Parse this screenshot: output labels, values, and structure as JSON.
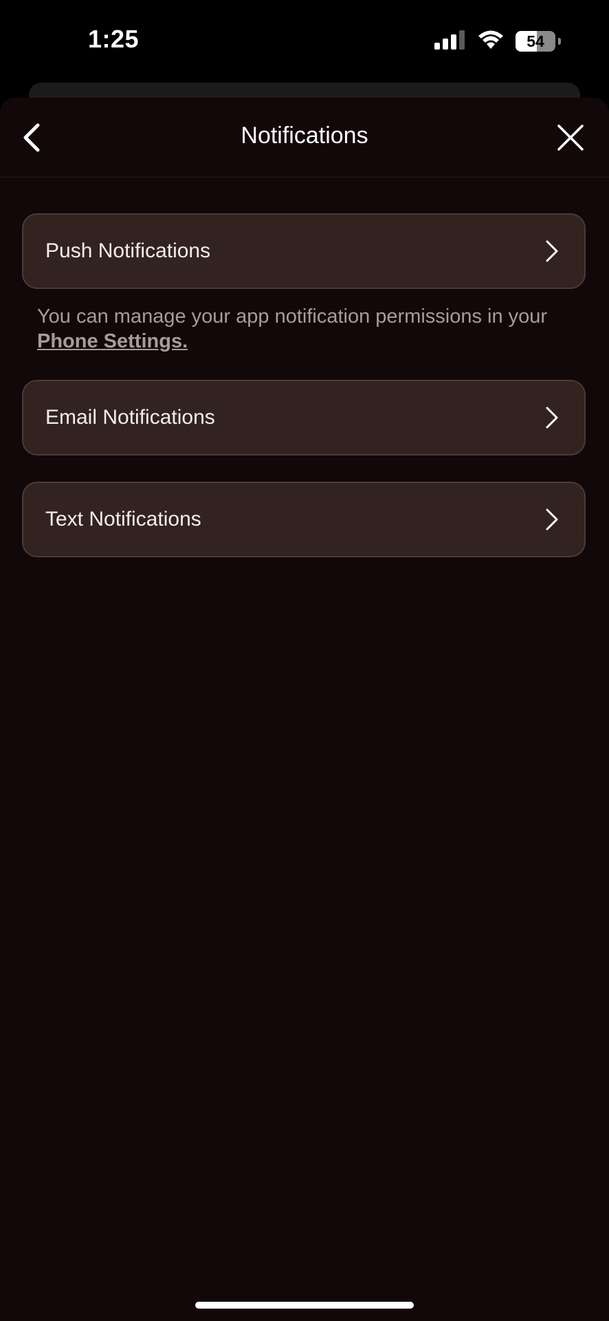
{
  "status_bar": {
    "time": "1:25",
    "battery_level": "54",
    "battery_fraction": 0.54,
    "icons": [
      "signal-icon",
      "wifi-icon",
      "battery-icon"
    ]
  },
  "nav": {
    "title": "Notifications",
    "back_icon": "chevron-left-icon",
    "close_icon": "close-icon"
  },
  "rows": [
    {
      "label": "Push Notifications",
      "icon": "chevron-right-icon"
    },
    {
      "label": "Email Notifications",
      "icon": "chevron-right-icon"
    },
    {
      "label": "Text Notifications",
      "icon": "chevron-right-icon"
    }
  ],
  "helper": {
    "text": "You can manage your app notification permissions in your ",
    "link": "Phone Settings."
  },
  "colors": {
    "background": "#120809",
    "row_background": "#332320",
    "row_border": "#4a3b38",
    "text_primary": "#ffffff",
    "text_secondary": "#a69d9b"
  }
}
